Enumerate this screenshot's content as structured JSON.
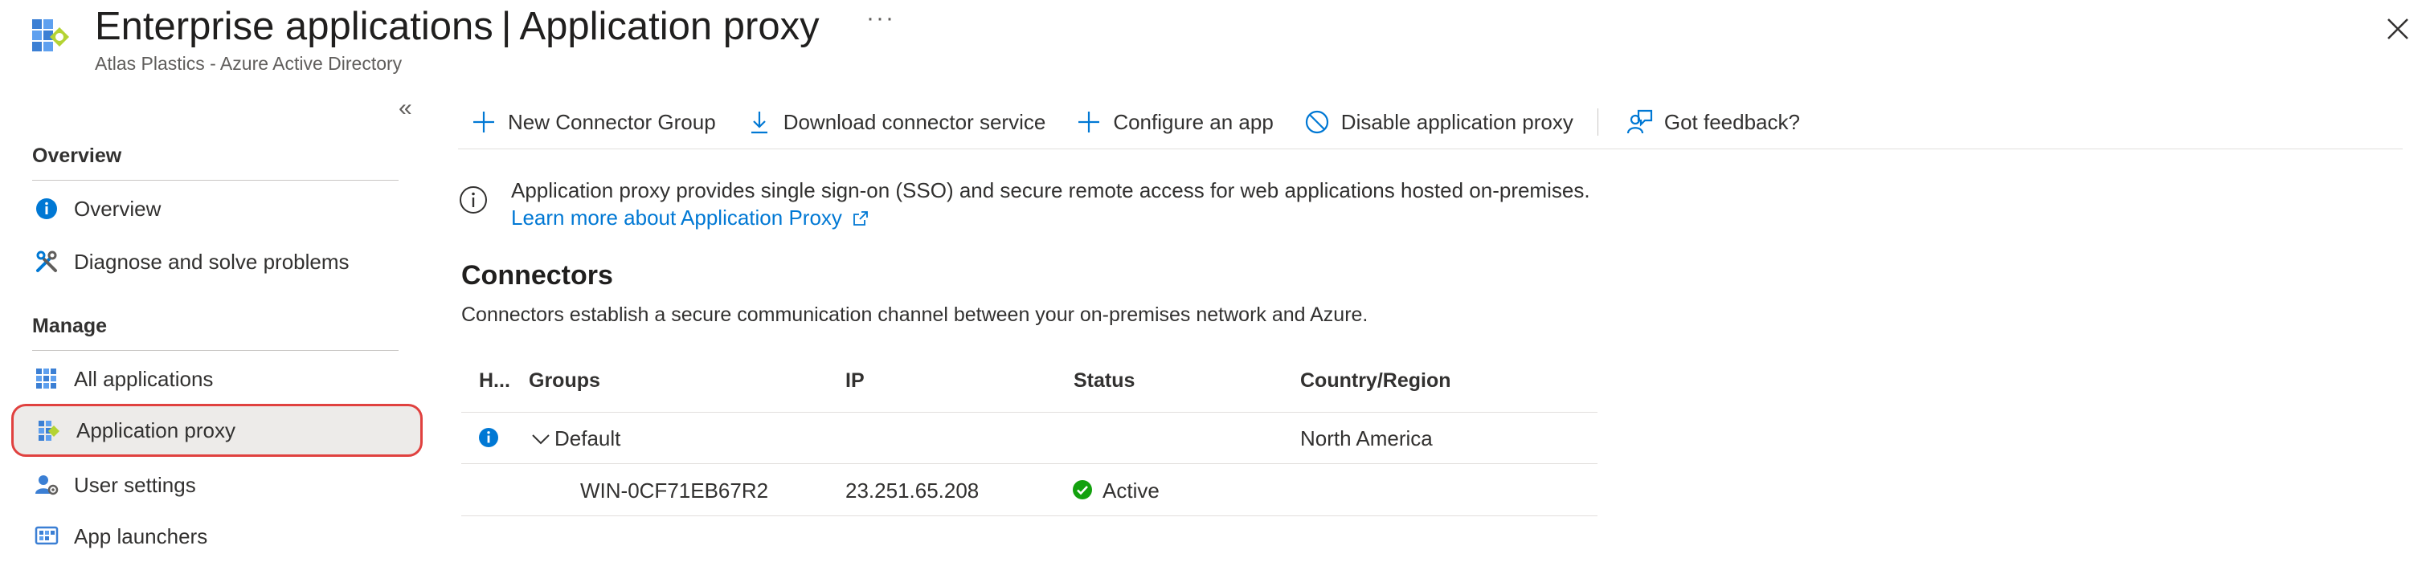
{
  "header": {
    "title_part1": "Enterprise applications",
    "title_separator": "|",
    "title_part2": "Application proxy",
    "more_label": "···",
    "subtitle": "Atlas Plastics - Azure Active Directory"
  },
  "sidebar": {
    "collapse_label": "«",
    "sections": [
      {
        "title": "Overview"
      },
      {
        "title": "Manage"
      }
    ],
    "items": [
      {
        "label": "Overview",
        "icon": "info-circle-icon"
      },
      {
        "label": "Diagnose and solve problems",
        "icon": "wrench-icon"
      },
      {
        "label": "All applications",
        "icon": "grid-icon"
      },
      {
        "label": "Application proxy",
        "icon": "app-proxy-icon",
        "selected": true
      },
      {
        "label": "User settings",
        "icon": "user-settings-icon"
      },
      {
        "label": "App launchers",
        "icon": "app-launchers-icon"
      }
    ]
  },
  "toolbar": {
    "new_connector_group": "New Connector Group",
    "download_connector_service": "Download connector service",
    "configure_app": "Configure an app",
    "disable_proxy": "Disable application proxy",
    "feedback": "Got feedback?"
  },
  "info": {
    "text": "Application proxy provides single sign-on (SSO) and secure remote access for web applications hosted on-premises.",
    "link": "Learn more about Application Proxy"
  },
  "connectors": {
    "title": "Connectors",
    "description": "Connectors establish a secure communication channel between your on-premises network and Azure.",
    "columns": {
      "health": "H...",
      "groups": "Groups",
      "ip": "IP",
      "status": "Status",
      "region": "Country/Region"
    },
    "group": {
      "name": "Default",
      "region": "North America"
    },
    "connector": {
      "name": "WIN-0CF71EB67R2",
      "ip": "23.251.65.208",
      "status": "Active"
    }
  },
  "colors": {
    "accent": "#0078d4",
    "success": "#13a10e",
    "highlight_border": "#e0413f"
  }
}
